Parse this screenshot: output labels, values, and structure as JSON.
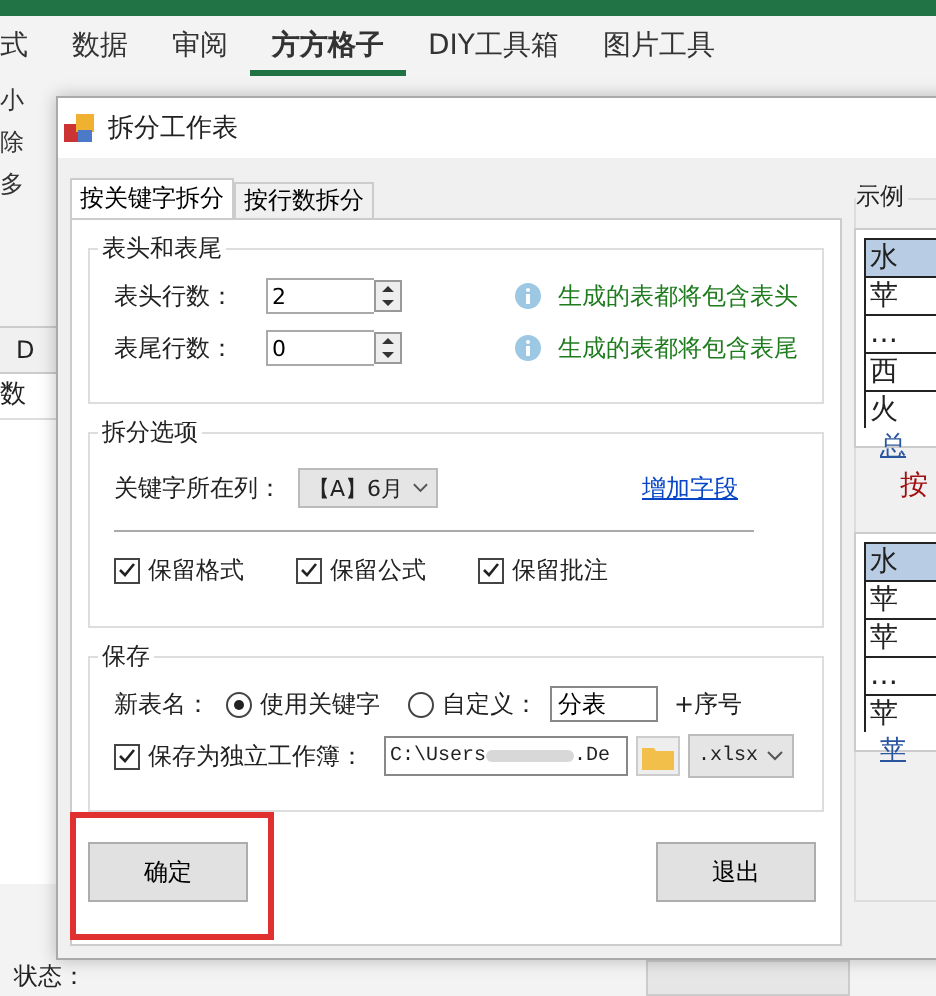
{
  "ribbon": {
    "tabs": [
      {
        "label": "式",
        "selected": false
      },
      {
        "label": "数据",
        "selected": false
      },
      {
        "label": "审阅",
        "selected": false
      },
      {
        "label": "方方格子",
        "selected": true
      },
      {
        "label": "DIY工具箱",
        "selected": false
      },
      {
        "label": "图片工具",
        "selected": false
      }
    ],
    "items": [
      "小",
      "除",
      "多"
    ]
  },
  "sheet": {
    "column_header": "D",
    "cell": "数"
  },
  "dialog": {
    "title": "拆分工作表",
    "tabs": [
      {
        "label": "按关键字拆分",
        "selected": true
      },
      {
        "label": "按行数拆分",
        "selected": false
      }
    ],
    "header_footer": {
      "title": "表头和表尾",
      "rows": [
        {
          "label": "表头行数：",
          "value": "2",
          "hint": "生成的表都将包含表头"
        },
        {
          "label": "表尾行数：",
          "value": "0",
          "hint": "生成的表都将包含表尾"
        }
      ]
    },
    "split_options": {
      "title": "拆分选项",
      "key_column_label": "关键字所在列：",
      "key_column_value": "【A】6月",
      "add_field_link": "增加字段",
      "checkboxes": [
        {
          "label": "保留格式",
          "checked": true
        },
        {
          "label": "保留公式",
          "checked": true
        },
        {
          "label": "保留批注",
          "checked": true
        }
      ]
    },
    "save": {
      "title": "保存",
      "new_name_label": "新表名：",
      "radios": [
        {
          "label": "使用关键字",
          "selected": true
        },
        {
          "label": "自定义：",
          "selected": false
        }
      ],
      "custom_value": "分表",
      "suffix": "+序号",
      "standalone": {
        "label": "保存为独立工作簿：",
        "checked": true
      },
      "path_start": "C:\\Users",
      "path_end": ".De",
      "format": ".xlsx"
    },
    "buttons": [
      {
        "label": "确定",
        "highlighted": true
      },
      {
        "label": "退出",
        "highlighted": false
      }
    ],
    "example": {
      "title": "示例",
      "tables": [
        {
          "cells": [
            "水",
            "苹",
            "…",
            "西",
            "火"
          ],
          "sheet_tab": "总"
        },
        {
          "cells": [
            "水",
            "苹",
            "苹",
            "…",
            "苹"
          ],
          "sheet_tab": "苹"
        }
      ],
      "caption": "按"
    }
  },
  "status_bar": {
    "label": "状态："
  }
}
